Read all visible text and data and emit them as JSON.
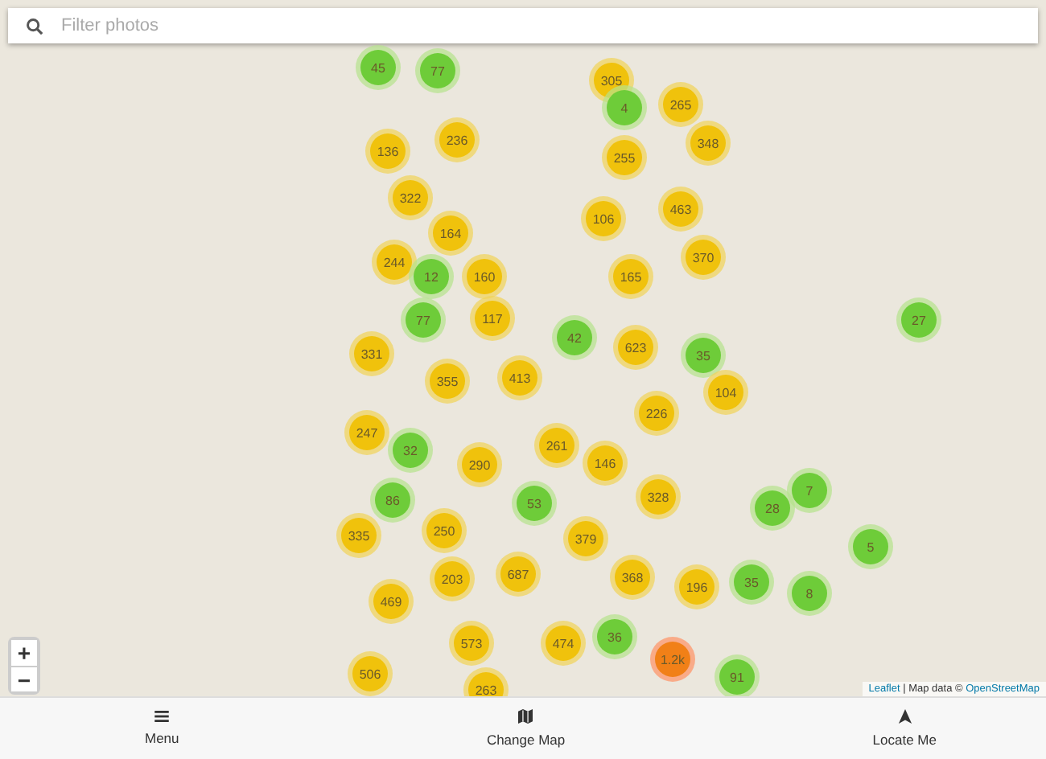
{
  "search": {
    "placeholder": "Filter photos"
  },
  "markers": [
    {
      "label": "45",
      "color": "#6ecc39"
    },
    {
      "label": "77",
      "color": "#6ecc39"
    },
    {
      "label": "305",
      "color": "#f0c20c"
    },
    {
      "label": "265",
      "color": "#f0c20c"
    },
    {
      "label": "4",
      "color": "#6ecc39"
    },
    {
      "label": "136",
      "color": "#f0c20c"
    },
    {
      "label": "236",
      "color": "#f0c20c"
    },
    {
      "label": "348",
      "color": "#f0c20c"
    },
    {
      "label": "255",
      "color": "#f0c20c"
    },
    {
      "label": "322",
      "color": "#f0c20c"
    },
    {
      "label": "463",
      "color": "#f0c20c"
    },
    {
      "label": "106",
      "color": "#f0c20c"
    },
    {
      "label": "164",
      "color": "#f0c20c"
    },
    {
      "label": "370",
      "color": "#f0c20c"
    },
    {
      "label": "244",
      "color": "#f0c20c"
    },
    {
      "label": "12",
      "color": "#6ecc39"
    },
    {
      "label": "160",
      "color": "#f0c20c"
    },
    {
      "label": "165",
      "color": "#f0c20c"
    },
    {
      "label": "77",
      "color": "#6ecc39"
    },
    {
      "label": "117",
      "color": "#f0c20c"
    },
    {
      "label": "27",
      "color": "#6ecc39"
    },
    {
      "label": "42",
      "color": "#6ecc39"
    },
    {
      "label": "331",
      "color": "#f0c20c"
    },
    {
      "label": "623",
      "color": "#f0c20c"
    },
    {
      "label": "35",
      "color": "#6ecc39"
    },
    {
      "label": "355",
      "color": "#f0c20c"
    },
    {
      "label": "413",
      "color": "#f0c20c"
    },
    {
      "label": "104",
      "color": "#f0c20c"
    },
    {
      "label": "226",
      "color": "#f0c20c"
    },
    {
      "label": "247",
      "color": "#f0c20c"
    },
    {
      "label": "32",
      "color": "#6ecc39"
    },
    {
      "label": "261",
      "color": "#f0c20c"
    },
    {
      "label": "146",
      "color": "#f0c20c"
    },
    {
      "label": "290",
      "color": "#f0c20c"
    },
    {
      "label": "7",
      "color": "#6ecc39"
    },
    {
      "label": "86",
      "color": "#6ecc39"
    },
    {
      "label": "53",
      "color": "#6ecc39"
    },
    {
      "label": "328",
      "color": "#f0c20c"
    },
    {
      "label": "28",
      "color": "#6ecc39"
    },
    {
      "label": "335",
      "color": "#f0c20c"
    },
    {
      "label": "250",
      "color": "#f0c20c"
    },
    {
      "label": "379",
      "color": "#f0c20c"
    },
    {
      "label": "5",
      "color": "#6ecc39"
    },
    {
      "label": "203",
      "color": "#f0c20c"
    },
    {
      "label": "687",
      "color": "#f0c20c"
    },
    {
      "label": "368",
      "color": "#f0c20c"
    },
    {
      "label": "196",
      "color": "#f0c20c"
    },
    {
      "label": "35",
      "color": "#6ecc39"
    },
    {
      "label": "8",
      "color": "#6ecc39"
    },
    {
      "label": "469",
      "color": "#f0c20c"
    },
    {
      "label": "474",
      "color": "#f0c20c"
    },
    {
      "label": "36",
      "color": "#6ecc39"
    },
    {
      "label": "573",
      "color": "#f0c20c"
    },
    {
      "label": "1.2k",
      "color": "#f18017"
    },
    {
      "label": "506",
      "color": "#f0c20c"
    },
    {
      "label": "91",
      "color": "#6ecc39"
    },
    {
      "label": "263",
      "color": "#f0c20c"
    }
  ],
  "zoom": {
    "in": "+",
    "out": "−"
  },
  "attribution": {
    "link": "Leaflet",
    "text": "| Map data ©",
    "source": "OpenStreetMap"
  },
  "nav": [
    {
      "kind": "menu",
      "label": "Menu"
    },
    {
      "kind": "map",
      "label": "Change Map"
    },
    {
      "kind": "locate",
      "label": "Locate Me"
    }
  ]
}
